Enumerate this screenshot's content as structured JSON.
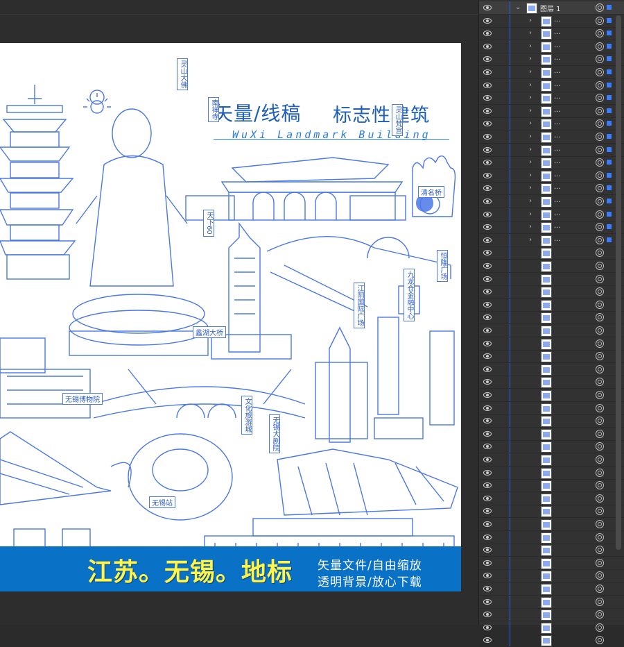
{
  "canvas": {
    "title": "矢量/线稿",
    "subtitle": "标志性建筑",
    "english": "WuXi Landmark Building",
    "labels_vertical": [
      "灵山大佛",
      "南禅寺",
      "灵山梵宫",
      "天下60",
      "江阴国际广场",
      "九龙仓金融中心",
      "恒隆广场",
      "文化旅游城",
      "无锡大剧院"
    ],
    "labels_horizontal": [
      "清名桥",
      "蠡湖大桥",
      "无锡博物院",
      "无锡站"
    ],
    "accent": "#4a78e6"
  },
  "banner": {
    "main": "江苏。无锡。地标",
    "line1": "矢量文件/自由缩放",
    "line2": "透明背景/放心下载",
    "bg": "#0a72c6",
    "main_color": "#fff44a"
  },
  "layers": {
    "group_name": "图层 1",
    "child_name": "...",
    "rows_total": 50,
    "rows_with_chevron": 18,
    "eye_icon": "eye-icon",
    "target_icon": "target-circle-icon",
    "selection_color": "#3a7dff"
  }
}
